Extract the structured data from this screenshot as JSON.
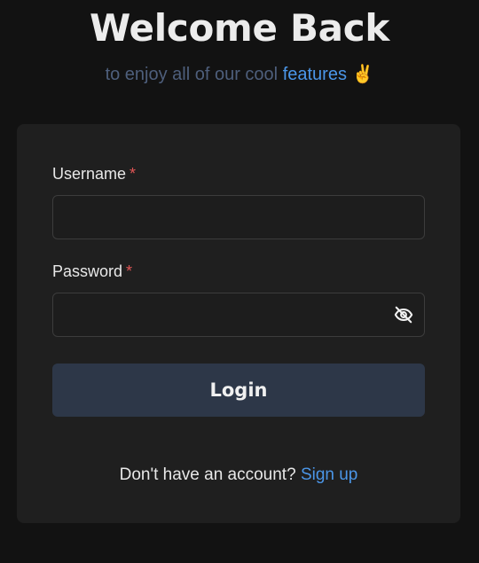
{
  "header": {
    "title": "Welcome Back",
    "subtitle_prefix": "to enjoy all of our cool",
    "subtitle_accent": "features",
    "subtitle_emoji": "✌"
  },
  "form": {
    "username_label": "Username",
    "password_label": "Password",
    "required_mark": "*",
    "username_value": "",
    "password_value": "",
    "password_toggle_icon": "eye-off-icon",
    "login_label": "Login"
  },
  "footer": {
    "prompt": "Don't have an account?",
    "signup_label": "Sign up"
  },
  "colors": {
    "background": "#121212",
    "card": "#1f1f1f",
    "accent": "#4b96e8",
    "required": "#e05555",
    "button": "#2d3748"
  }
}
